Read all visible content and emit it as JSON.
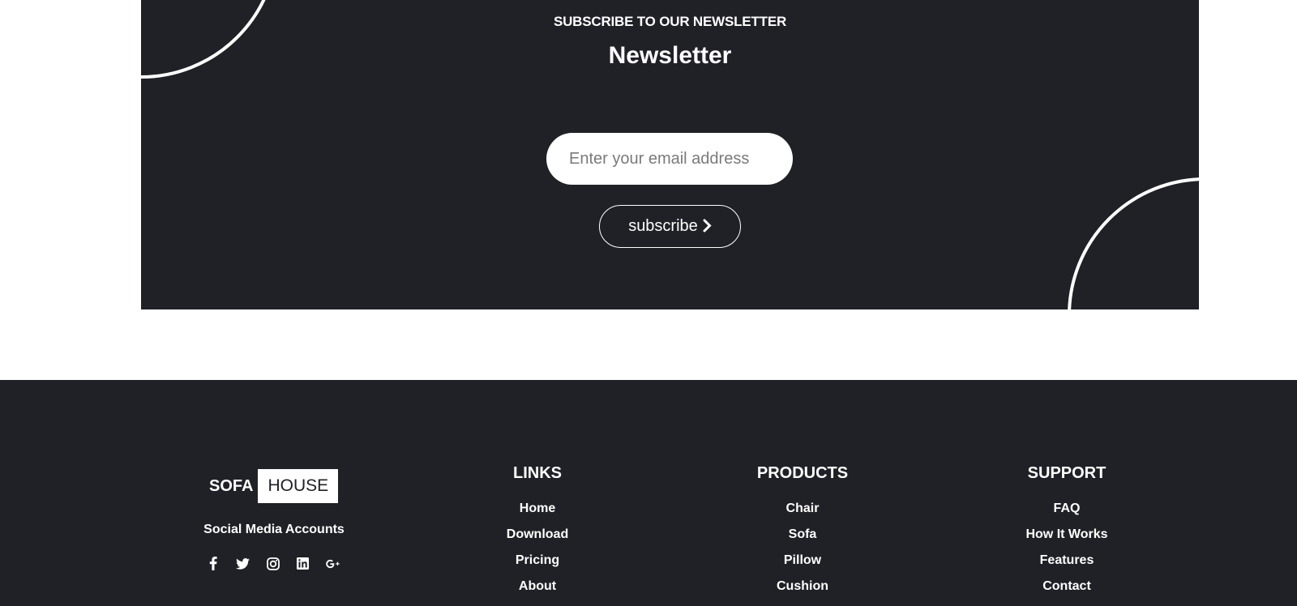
{
  "newsletter": {
    "eyebrow": "SUBSCRIBE TO OUR NEWSLETTER",
    "title": "Newsletter",
    "email_placeholder": "Enter your email address",
    "subscribe_label": "subscribe"
  },
  "footer": {
    "logo": {
      "part1": "SOFA",
      "part2": "HOUSE"
    },
    "social_label": "Social Media Accounts",
    "social_icons": [
      "facebook-icon",
      "twitter-icon",
      "instagram-icon",
      "linkedin-icon",
      "google-plus-icon"
    ],
    "columns": {
      "links": {
        "title": "LINKS",
        "items": [
          "Home",
          "Download",
          "Pricing",
          "About"
        ]
      },
      "products": {
        "title": "PRODUCTS",
        "items": [
          "Chair",
          "Sofa",
          "Pillow",
          "Cushion"
        ]
      },
      "support": {
        "title": "SUPPORT",
        "items": [
          "FAQ",
          "How It Works",
          "Features",
          "Contact"
        ]
      }
    }
  },
  "colors": {
    "dark_bg": "#202127",
    "white": "#ffffff"
  }
}
